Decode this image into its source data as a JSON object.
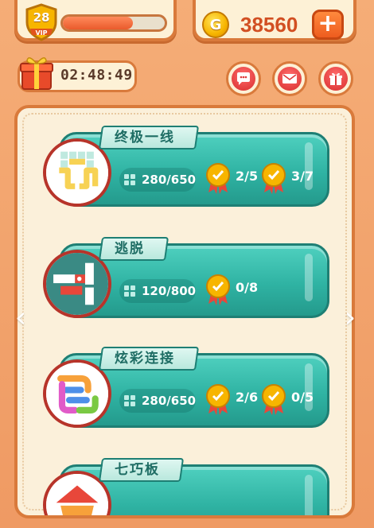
{
  "header": {
    "vip_level": "28",
    "vip_tag": "VIP",
    "exp_progress": 0.69,
    "coin_symbol": "G",
    "coins": "38560",
    "add_label": "+",
    "timer": "02:48:49"
  },
  "buttons": {
    "chat": "chat-icon",
    "mail": "mail-icon",
    "gift": "gift-icon"
  },
  "games": [
    {
      "title": "终极一线",
      "progress": "280/650",
      "medals": [
        "2/5",
        "3/7"
      ]
    },
    {
      "title": "逃脱",
      "progress": "120/800",
      "medals": [
        "0/8"
      ]
    },
    {
      "title": "炫彩连接",
      "progress": "280/650",
      "medals": [
        "2/6",
        "0/5"
      ]
    },
    {
      "title": "七巧板",
      "progress": "",
      "medals": []
    }
  ],
  "nav": {
    "prev": "‹",
    "next": "›"
  },
  "colors": {
    "background": "#f2a46c",
    "card": "#2fb3a3",
    "accent": "#ee5c1f",
    "coin_text": "#d24f22"
  }
}
